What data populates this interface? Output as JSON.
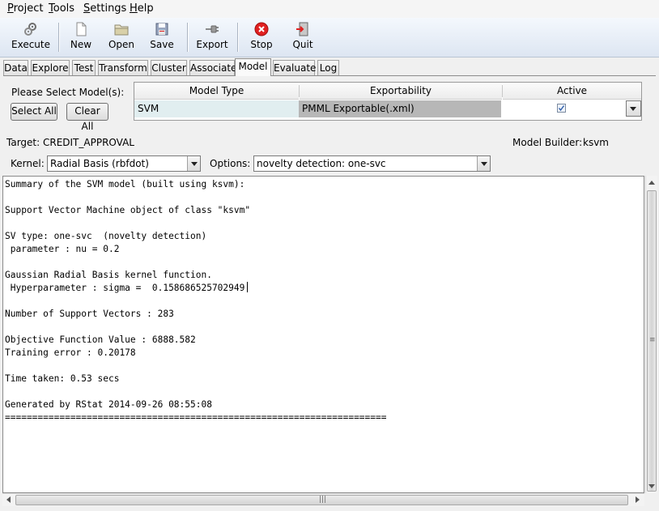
{
  "menu": [
    "Project",
    "Tools",
    "Settings",
    "Help"
  ],
  "toolbar": {
    "execute": "Execute",
    "new": "New",
    "open": "Open",
    "save": "Save",
    "export": "Export",
    "stop": "Stop",
    "quit": "Quit"
  },
  "tabs": [
    "Data",
    "Explore",
    "Test",
    "Transform",
    "Cluster",
    "Associate",
    "Model",
    "Evaluate",
    "Log"
  ],
  "active_tab": "Model",
  "model_select": {
    "prompt": "Please Select Model(s):",
    "select_all": "Select All",
    "clear_all": "Clear All"
  },
  "model_table": {
    "headers": [
      "Model Type",
      "Exportability",
      "Active"
    ],
    "row": {
      "model_type": "SVM",
      "exportability": "PMML Exportable(.xml)",
      "active": true
    }
  },
  "target_label": "Target: CREDIT_APPROVAL",
  "model_builder": {
    "label": "Model Builder:",
    "value": "ksvm"
  },
  "kernel": {
    "label": "Kernel:",
    "value": "Radial Basis (rbfdot)"
  },
  "options": {
    "label": "Options:",
    "value": "novelty detection: one-svc"
  },
  "output": {
    "lines": [
      "Summary of the SVM model (built using ksvm):",
      "",
      "Support Vector Machine object of class \"ksvm\"",
      "",
      "SV type: one-svc  (novelty detection)",
      " parameter : nu = 0.2",
      "",
      "Gaussian Radial Basis kernel function.",
      " Hyperparameter : sigma =  0.158686525702949",
      "",
      "Number of Support Vectors : 283",
      "",
      "Objective Function Value : 6888.582",
      "Training error : 0.20178",
      "",
      "Time taken: 0.53 secs",
      "",
      "Generated by RStat 2014-09-26 08:55:08",
      "======================================================================"
    ]
  },
  "colors": {
    "model_type_cell": "#e1eef0",
    "exportability_cell": "#b7b7b7",
    "toolbar_top": "#f4f8fd",
    "toolbar_bottom": "#dde6f2",
    "stop_red": "#e02020"
  }
}
